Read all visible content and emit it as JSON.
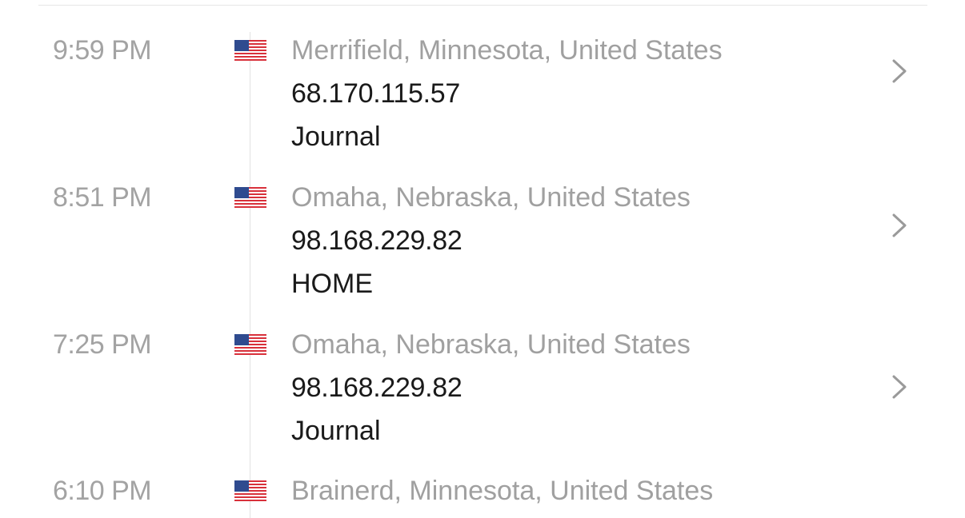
{
  "sessions": [
    {
      "time": "9:59 PM",
      "flag": "us-flag-icon",
      "location": "Merrifield, Minnesota, United States",
      "ip": "68.170.115.57",
      "label": "Journal"
    },
    {
      "time": "8:51 PM",
      "flag": "us-flag-icon",
      "location": "Omaha, Nebraska, United States",
      "ip": "98.168.229.82",
      "label": "HOME"
    },
    {
      "time": "7:25 PM",
      "flag": "us-flag-icon",
      "location": "Omaha, Nebraska, United States",
      "ip": "98.168.229.82",
      "label": "Journal"
    },
    {
      "time": "6:10 PM",
      "flag": "us-flag-icon",
      "location": "Brainerd, Minnesota, United States",
      "ip": "",
      "label": ""
    }
  ],
  "colors": {
    "time": "#a3a3a3",
    "location": "#a0a0a0",
    "primary_text": "#1a1a1a",
    "chevron": "#9a9a9a",
    "divider": "#e6e6e6"
  }
}
